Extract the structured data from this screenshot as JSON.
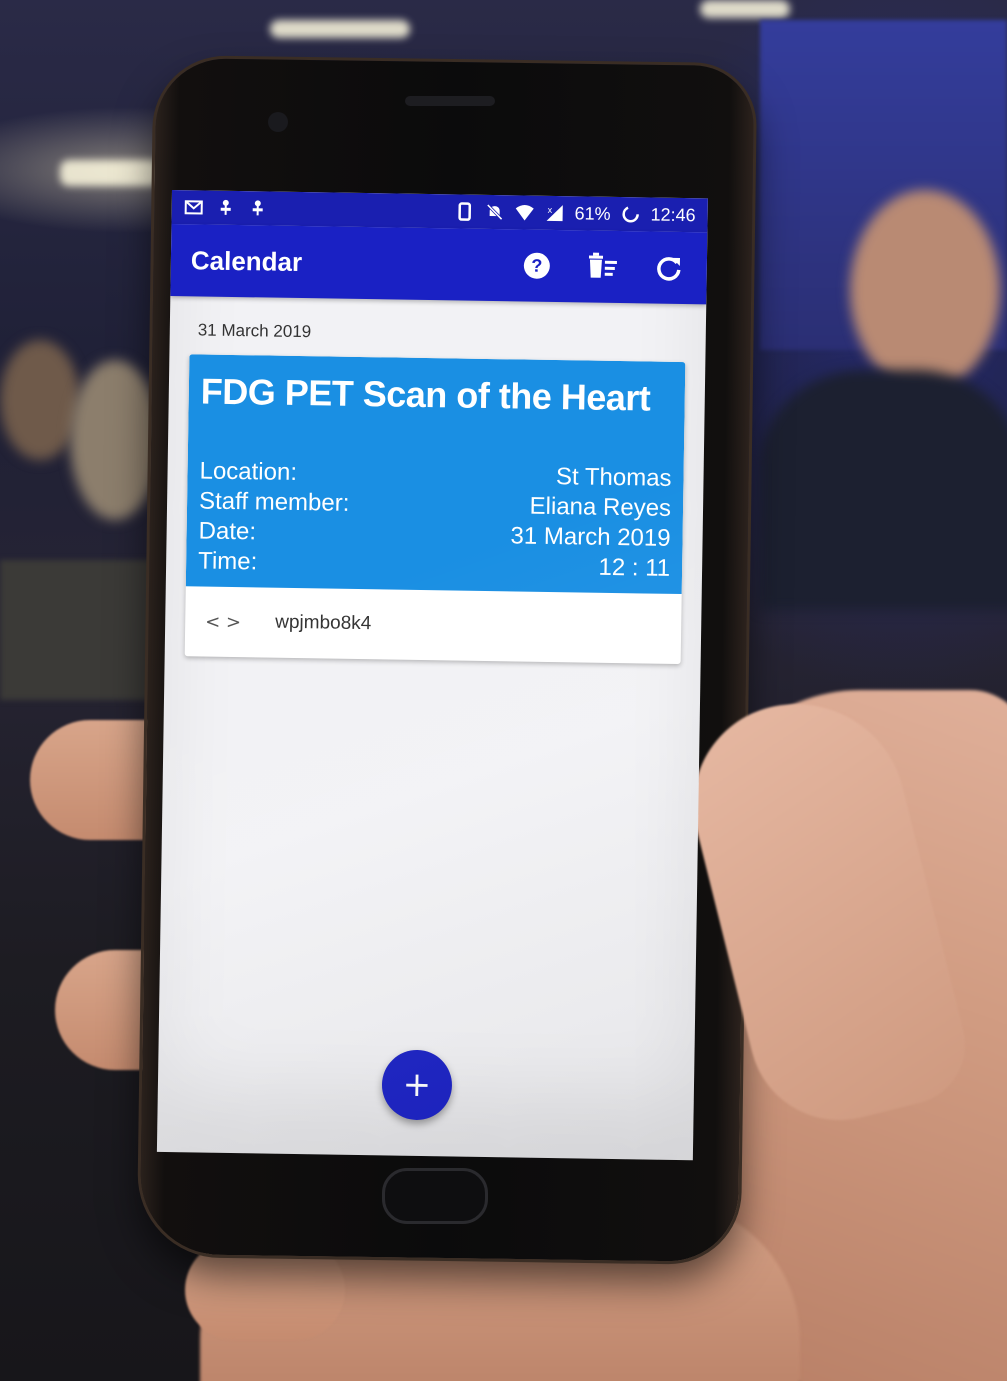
{
  "status_bar": {
    "battery": "61%",
    "time": "12:46",
    "left_icons": [
      "gmail-icon",
      "usb-icon",
      "usb-icon"
    ],
    "right_icons": [
      "phone-icon",
      "notifications-off-icon",
      "wifi-icon",
      "signal-icon",
      "battery-icon"
    ]
  },
  "app_bar": {
    "title": "Calendar",
    "actions": [
      "help-icon",
      "delete-sweep-icon",
      "refresh-icon"
    ]
  },
  "section": {
    "date_header": "31 March 2019"
  },
  "appointment": {
    "title": "FDG PET Scan of the Heart",
    "details": [
      {
        "label": "Location:",
        "value": "St Thomas"
      },
      {
        "label": "Staff member:",
        "value": "Eliana Reyes"
      },
      {
        "label": "Date:",
        "value": "31 March 2019"
      },
      {
        "label": "Time:",
        "value": "12 : 11"
      }
    ],
    "code_icon": "< >",
    "code": "wpjmbo8k4"
  },
  "fab": {
    "label": "+"
  },
  "colors": {
    "app_bar": "#1a21c4",
    "status_bar": "#1a1fb0",
    "card_header": "#1a8fe3",
    "fab": "#1a21c4"
  }
}
